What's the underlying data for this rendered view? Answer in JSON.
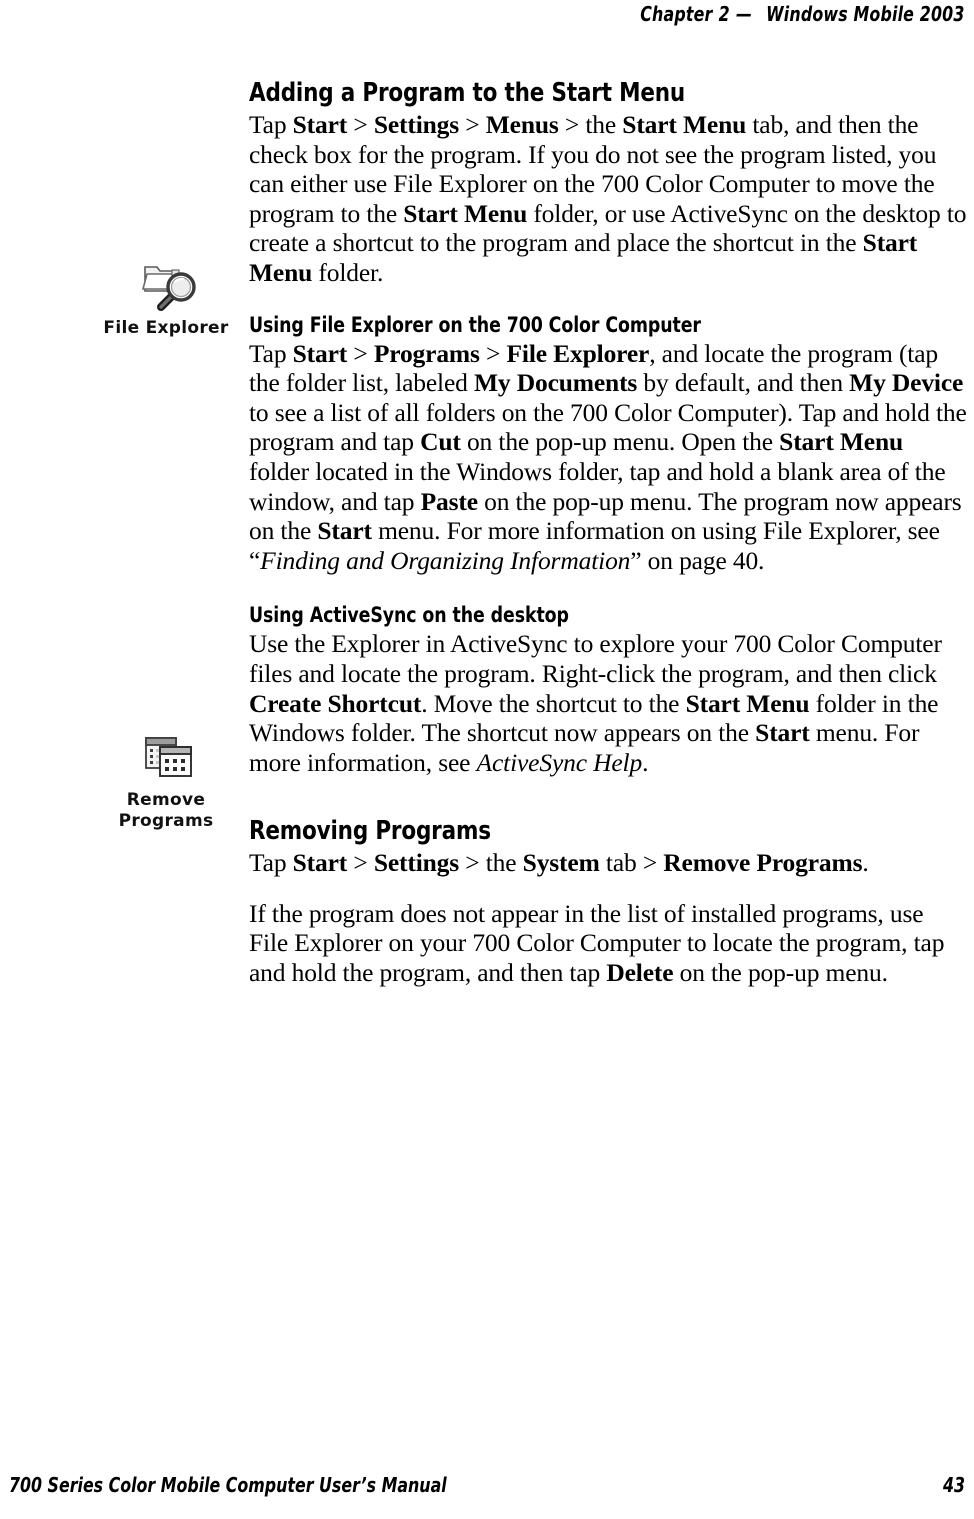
{
  "header": {
    "chapter_label": "Chapter",
    "chapter_number": "2",
    "dash": "—",
    "title": "Windows Mobile 2003"
  },
  "footer": {
    "manual_title": "700 Series Color Mobile Computer User’s Manual",
    "page_number": "43"
  },
  "icons": {
    "file_explorer": {
      "name": "file-explorer-icon",
      "caption": "File Explorer"
    },
    "remove_programs": {
      "name": "remove-programs-icon",
      "caption_line1": "Remove",
      "caption_line2": "Programs"
    }
  },
  "sections": {
    "adding_program": {
      "heading": "Adding a Program to the Start Menu",
      "paragraph": {
        "p1": "Tap ",
        "b1": "Start",
        "p2": " > ",
        "b2": "Settings",
        "p3": " > ",
        "b3": "Menus",
        "p4": " > the ",
        "b4": "Start Menu",
        "p5": " tab, and then the check box for the program. If you do not see the program listed, you can either use File Explorer on the 700 Color Computer to move the program to the ",
        "b5": "Start Menu",
        "p6": " folder, or use ActiveSync on the desktop to create a shortcut to the program and place the shortcut in the ",
        "b6": "Start Menu",
        "p7": " folder."
      }
    },
    "using_file_explorer": {
      "heading": "Using File Explorer on the 700 Color Computer",
      "paragraph": {
        "p1": "Tap ",
        "b1": "Start",
        "p2": " > ",
        "b2": "Programs",
        "p3": " > ",
        "b3": "File Explorer",
        "p4": ", and locate the program (tap the folder list, labeled ",
        "b4": "My Documents",
        "p5": " by default, and then ",
        "b5": "My Device",
        "p6": " to see a list of all folders on the 700 Color Computer). Tap and hold the program and tap ",
        "b6": "Cut",
        "p7": " on the pop-up menu. Open the ",
        "b7": "Start Menu",
        "p8": " folder located in the Windows folder, tap and hold a blank area of the window, and tap ",
        "b8": "Paste",
        "p9": " on the pop-up menu. The program now appears on the ",
        "b9": "Start",
        "p10": " menu. For more information on using File Explorer, see “",
        "i1": "Finding and Organizing Information",
        "p11": "” on page 40."
      }
    },
    "using_activesync": {
      "heading": "Using ActiveSync on the desktop",
      "paragraph": {
        "p1": "Use the Explorer in ActiveSync to explore your 700 Color Computer files and locate the program. Right-click the program, and then click ",
        "b1": "Create Shortcut",
        "p2": ". Move the shortcut to the ",
        "b2": "Start Menu",
        "p3": " folder in the Windows folder. The shortcut now appears on the ",
        "b3": "Start",
        "p4": " menu. For more information, see ",
        "i1": "ActiveSync Help",
        "p5": "."
      }
    },
    "removing_programs": {
      "heading": "Removing Programs",
      "paragraph_1": {
        "p1": "Tap ",
        "b1": "Start",
        "p2": " > ",
        "b2": "Settings",
        "p3": " > the ",
        "b3": "System",
        "p4": " tab > ",
        "b4": "Remove Programs",
        "p5": "."
      },
      "paragraph_2": {
        "p1": "If the program does not appear in the list of installed programs, use File Explorer on your 700 Color Computer to locate the program, tap and hold the program, and then tap ",
        "b1": "Delete",
        "p2": " on the pop-up menu."
      }
    }
  },
  "colors": {
    "text": "#000000",
    "page_background": "#ffffff"
  }
}
